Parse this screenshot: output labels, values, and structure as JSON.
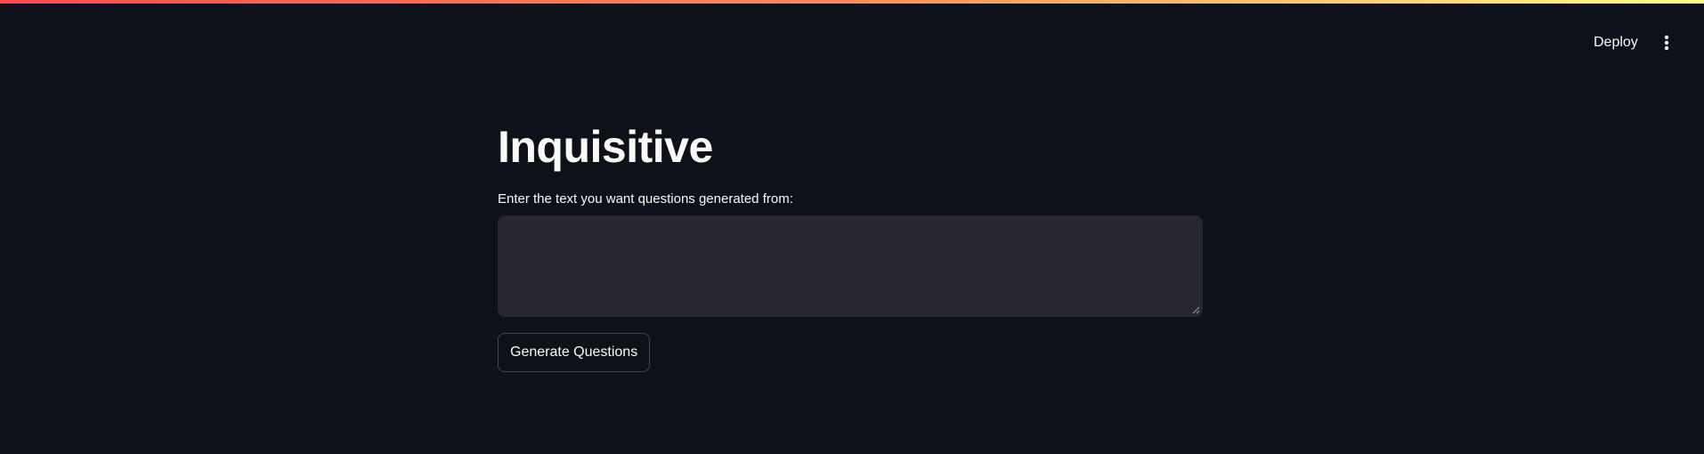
{
  "header": {
    "deploy_label": "Deploy",
    "menu_icon": "vertical-ellipsis-icon"
  },
  "main": {
    "title": "Inquisitive",
    "input_label": "Enter the text you want questions generated from:",
    "input_value": "",
    "button_label": "Generate Questions"
  },
  "colors": {
    "background": "#0e1117",
    "input_background": "#262730",
    "text": "#fafafa",
    "decoration_start": "#ff4b4b",
    "decoration_end": "#fffd80"
  }
}
